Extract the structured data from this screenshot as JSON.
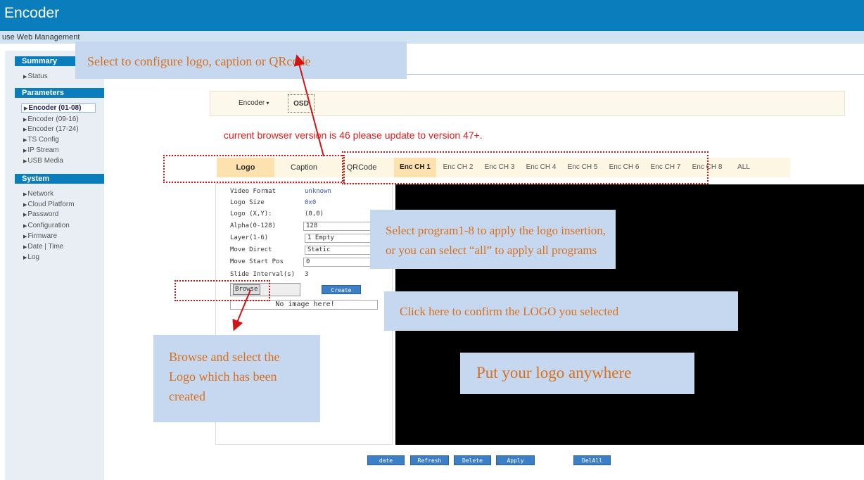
{
  "app": {
    "title": "Encoder",
    "subtitle": "use Web Management"
  },
  "sidebar": {
    "summary": {
      "header": "Summary",
      "items": [
        {
          "label": "Status"
        }
      ]
    },
    "parameters": {
      "header": "Parameters",
      "items": [
        {
          "label": "Encoder (01-08)",
          "active": true
        },
        {
          "label": "Encoder (09-16)"
        },
        {
          "label": "Encoder (17-24)"
        },
        {
          "label": "TS Config"
        },
        {
          "label": "IP Stream"
        },
        {
          "label": "USB Media"
        }
      ]
    },
    "system": {
      "header": "System",
      "items": [
        {
          "label": "Network"
        },
        {
          "label": "Cloud Platform"
        },
        {
          "label": "Password"
        },
        {
          "label": "Configuration"
        },
        {
          "label": "Firmware"
        },
        {
          "label": "Date | Time"
        },
        {
          "label": "Log"
        }
      ]
    }
  },
  "menubar": {
    "encoder": "Encoder",
    "osd": "OSD"
  },
  "warning": "current browser version is 46 please update to version 47+.",
  "tabs": {
    "logo": "Logo",
    "caption": "Caption",
    "qrcode": "QRCode"
  },
  "channels": [
    "Enc CH 1",
    "Enc CH 2",
    "Enc CH 3",
    "Enc CH 4",
    "Enc CH 5",
    "Enc CH 6",
    "Enc CH 7",
    "Enc CH 8",
    "ALL"
  ],
  "form": {
    "video_format": {
      "label": "Video Format",
      "value": "unknown"
    },
    "logo_size": {
      "label": "Logo Size",
      "value": "0x0"
    },
    "logo_xy": {
      "label": "Logo (X,Y):",
      "value": "(0,0)"
    },
    "alpha": {
      "label": "Alpha(0-128)",
      "value": "128"
    },
    "layer": {
      "label": "Layer(1-6)",
      "value": "1 Empty"
    },
    "move_direct": {
      "label": "Move Direct",
      "value": "Static"
    },
    "move_start": {
      "label": "Move Start Pos",
      "value": "0"
    },
    "slide_interval": {
      "label": "Slide Interval(s)",
      "value": "3"
    },
    "browse": "Browse",
    "create": "Create",
    "no_image": "No image here!"
  },
  "bottom_buttons": {
    "update": "date",
    "refresh": "Refresh",
    "delete": "Delete",
    "apply": "Apply",
    "delall": "DelAll"
  },
  "callouts": {
    "select_config": "Select to configure logo, caption or QRcode",
    "select_program": "Select program1-8 to apply the logo insertion, or you can select “all” to apply all programs",
    "confirm_logo": "Click here to confirm the LOGO you selected",
    "browse_logo": "Browse and select the Logo which has been created",
    "put_logo": "Put your logo anywhere"
  },
  "colors": {
    "brand": "#0a7dbd",
    "warning": "#e31b1b",
    "callout_bg": "#c5d8ef",
    "callout_text": "#d9701c",
    "annotation": "#d01515"
  }
}
